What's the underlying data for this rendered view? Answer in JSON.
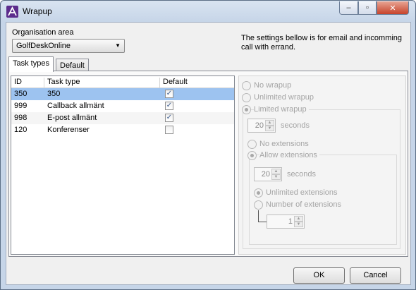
{
  "window": {
    "title": "Wrapup",
    "minimize": "–",
    "maximize": "▫",
    "close": "✕"
  },
  "org": {
    "label": "Organisation area",
    "selected": "GolfDeskOnline",
    "arrow": "▼"
  },
  "info": "The settings bellow is for email and incomming call with errand.",
  "tabs": [
    {
      "label": "Task types"
    },
    {
      "label": "Default"
    }
  ],
  "table": {
    "headers": {
      "id": "ID",
      "task_type": "Task type",
      "default": "Default"
    },
    "rows": [
      {
        "id": "350",
        "task_type": "350",
        "checked": "✓"
      },
      {
        "id": "999",
        "task_type": "Callback allmänt",
        "checked": "✓"
      },
      {
        "id": "998",
        "task_type": "E-post allmänt",
        "checked": "✓"
      },
      {
        "id": "120",
        "task_type": "Konferenser",
        "checked": ""
      }
    ]
  },
  "wrapup": {
    "no_wrapup": "No wrapup",
    "unlimited_wrapup": "Unlimited wrapup",
    "limited_wrapup": "Limited wrapup",
    "limited_seconds": "20",
    "seconds_label": "seconds",
    "no_extensions": "No extensions",
    "allow_extensions": "Allow extensions",
    "ext_seconds": "20",
    "ext_seconds_label": "seconds",
    "unlimited_extensions": "Unlimited extensions",
    "number_of_extensions": "Number of extensions",
    "extensions_count": "1"
  },
  "buttons": {
    "ok": "OK",
    "cancel": "Cancel"
  },
  "colors": {
    "selected_row": "#9dc3f0",
    "icon": "#5c2c8c"
  }
}
